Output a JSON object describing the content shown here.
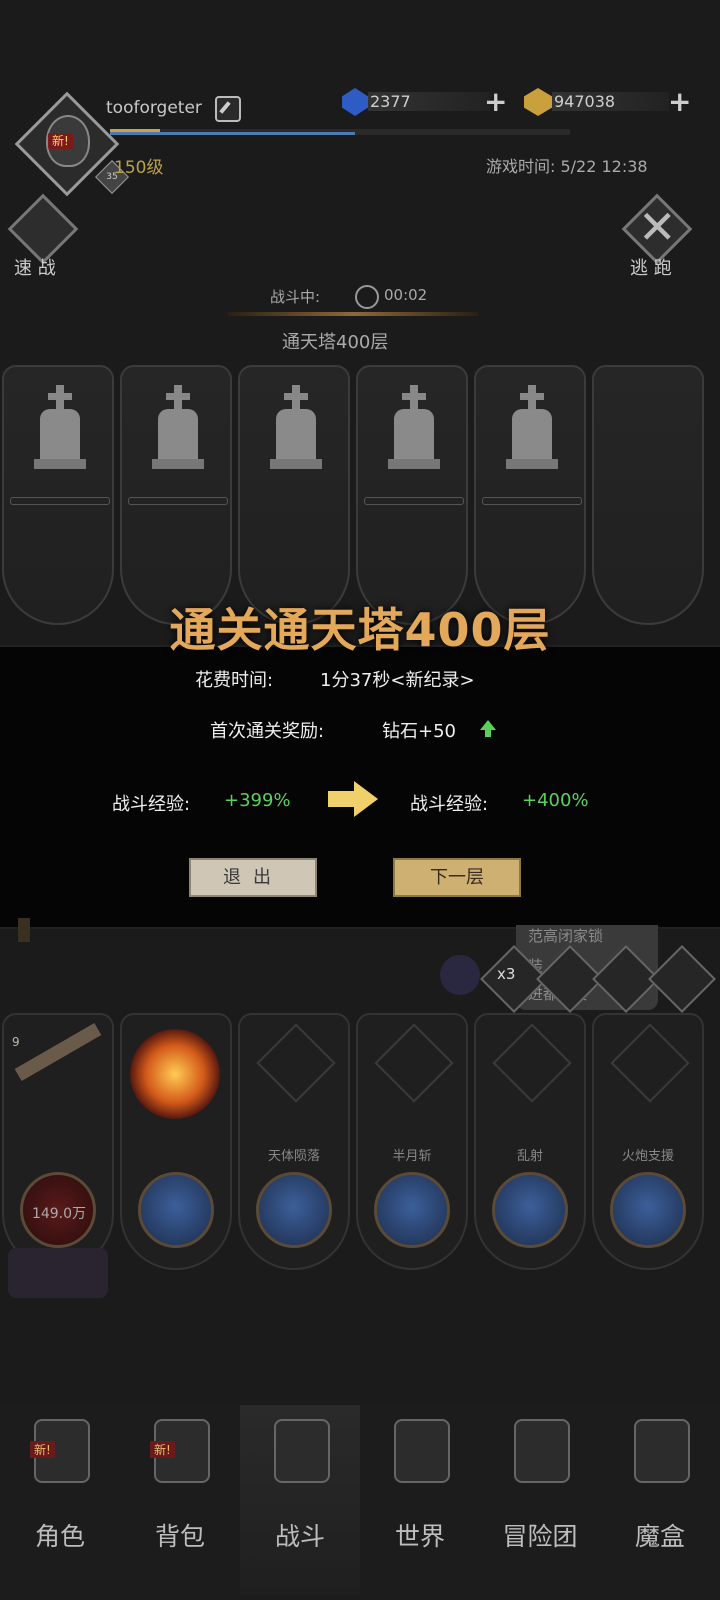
{
  "header": {
    "username": "tooforgeter",
    "level": "150级",
    "avatar_badge": "新!",
    "level_badge": "35",
    "diamonds": "2377",
    "gold": "947038",
    "game_time": "游戏时间: 5/22 12:38",
    "plus": "+"
  },
  "controls": {
    "quick_battle": "速 战",
    "escape": "逃 跑"
  },
  "battle": {
    "status": "战斗中:",
    "timer": "00:02",
    "floor": "通天塔400层"
  },
  "dialog": {
    "title": "通关通天塔400层",
    "time_label": "花费时间:",
    "time_value": "1分37秒<新纪录>",
    "reward_label": "首次通关奖励:",
    "reward_value": "钻石+50",
    "exp_label_before": "战斗经验:",
    "exp_value_before": "+399%",
    "exp_label_after": "战斗经验:",
    "exp_value_after": "+400%",
    "exit_button": "退出",
    "next_button": "下一层"
  },
  "side": {
    "bubble_lines": [
      "范高闭家锁",
      "装",
      "进都不要"
    ],
    "speed": "x3"
  },
  "skills": [
    {
      "name": "",
      "value": "149.0万",
      "badge": "9"
    },
    {
      "name": "",
      "value": ""
    },
    {
      "name": "天体陨落",
      "value": ""
    },
    {
      "name": "半月斩",
      "value": ""
    },
    {
      "name": "乱射",
      "value": ""
    },
    {
      "name": "火炮支援",
      "value": ""
    }
  ],
  "nav": {
    "items": [
      {
        "label": "角色",
        "badge": "新!"
      },
      {
        "label": "背包",
        "badge": "新!"
      },
      {
        "label": "战斗",
        "badge": ""
      },
      {
        "label": "世界",
        "badge": ""
      },
      {
        "label": "冒险团",
        "badge": ""
      },
      {
        "label": "魔盒",
        "badge": ""
      }
    ],
    "active_index": 2
  },
  "colors": {
    "gold_text": "#e4a85a",
    "green_text": "#5cd05c",
    "level_text": "#b9a24b"
  }
}
